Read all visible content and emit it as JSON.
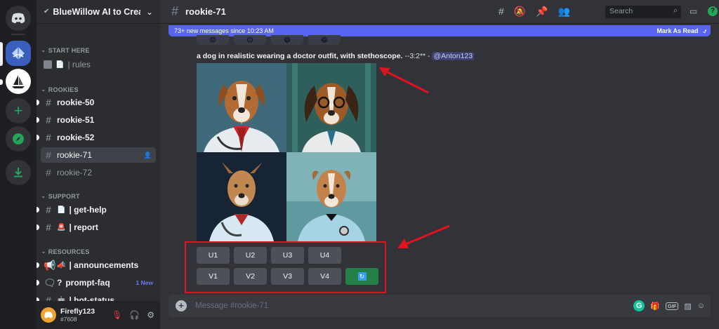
{
  "rail": {
    "servers": [
      "discord-home",
      "bluewillow-server",
      "sailboat-server",
      "add-server",
      "explore-servers",
      "download-apps"
    ]
  },
  "sidebar": {
    "guild_name": "BlueWillow AI to Crea...",
    "categories": {
      "start_here": "START HERE",
      "rookies": "ROOKIES",
      "support": "SUPPORT",
      "resources": "RESOURCES"
    },
    "channels": {
      "rules": "| rules",
      "rookie_50": "rookie-50",
      "rookie_51": "rookie-51",
      "rookie_52": "rookie-52",
      "rookie_71": "rookie-71",
      "rookie_72": "rookie-72",
      "get_help": "| get-help",
      "report": "| report",
      "announcements": "| announcements",
      "prompt_faq": "prompt-faq",
      "prompt_faq_prefix": "?",
      "prompt_faq_badge": "1 New",
      "bot_status": "| bot-status"
    }
  },
  "user": {
    "name": "Firefly123",
    "tag": "#7608"
  },
  "topbar": {
    "channel": "rookie-71",
    "search_placeholder": "Search"
  },
  "banner": {
    "new_messages": "73+ new messages since 10:23 AM",
    "mark_as_read": "Mark As Read"
  },
  "message": {
    "prompt": "a dog in realistic wearing a doctor outfit, with stethoscope.",
    "params": " --3:2** - ",
    "mention": "@Anton123"
  },
  "buttons": {
    "upscale": [
      "U1",
      "U2",
      "U3",
      "U4"
    ],
    "variation": [
      "V1",
      "V2",
      "V3",
      "V4"
    ],
    "reroll_icon": "refresh-icon"
  },
  "composer": {
    "placeholder": "Message #rookie-71"
  },
  "colors": {
    "blurple": "#5865f2",
    "highlight_red": "#e0141e",
    "green_button": "#248046"
  }
}
